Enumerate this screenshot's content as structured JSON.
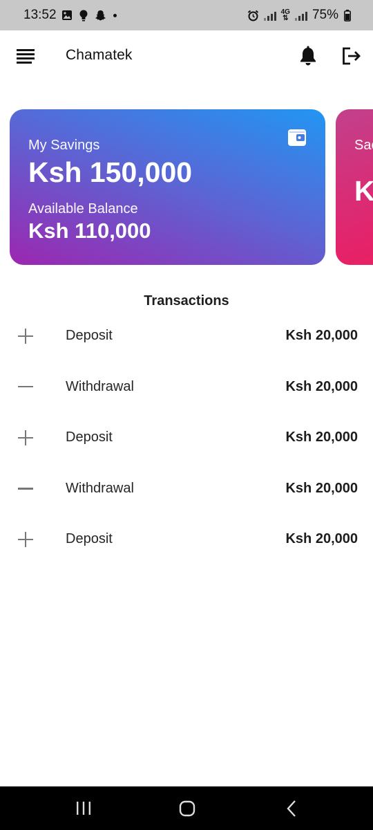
{
  "status_bar": {
    "time": "13:52",
    "left_icons": [
      "gallery-icon",
      "bulb-icon",
      "snapchat-icon",
      "dot-icon"
    ],
    "right_icons": [
      "alarm-icon",
      "signal-icon",
      "network-4g-icon",
      "signal-icon"
    ],
    "network_label": "4G",
    "battery": "75%"
  },
  "app_bar": {
    "title": "Chamatek",
    "menu_icon": "menu-icon",
    "notifications_icon": "bell-icon",
    "logout_icon": "logout-icon"
  },
  "cards": {
    "main": {
      "label": "My Savings",
      "amount": "Ksh 150,000",
      "balance_label": "Available Balance",
      "balance_amount": "Ksh 110,000",
      "icon": "wallet-icon",
      "gradient": [
        "#2196f3",
        "#9c27b0"
      ]
    },
    "partial": {
      "label": "Sac",
      "amount": "K",
      "gradient": [
        "#c2408c",
        "#ee1e5a"
      ]
    }
  },
  "transactions": {
    "heading": "Transactions",
    "items": [
      {
        "sign": "plus",
        "type": "Deposit",
        "amount": "Ksh 20,000"
      },
      {
        "sign": "minus",
        "type": "Withdrawal",
        "amount": "Ksh 20,000"
      },
      {
        "sign": "plus",
        "type": "Deposit",
        "amount": "Ksh 20,000"
      },
      {
        "sign": "minus",
        "type": "Withdrawal",
        "amount": "Ksh 20,000"
      },
      {
        "sign": "plus",
        "type": "Deposit",
        "amount": "Ksh 20,000"
      }
    ]
  },
  "nav_bar": {
    "buttons": [
      "recent-apps-icon",
      "home-icon",
      "back-icon"
    ]
  }
}
